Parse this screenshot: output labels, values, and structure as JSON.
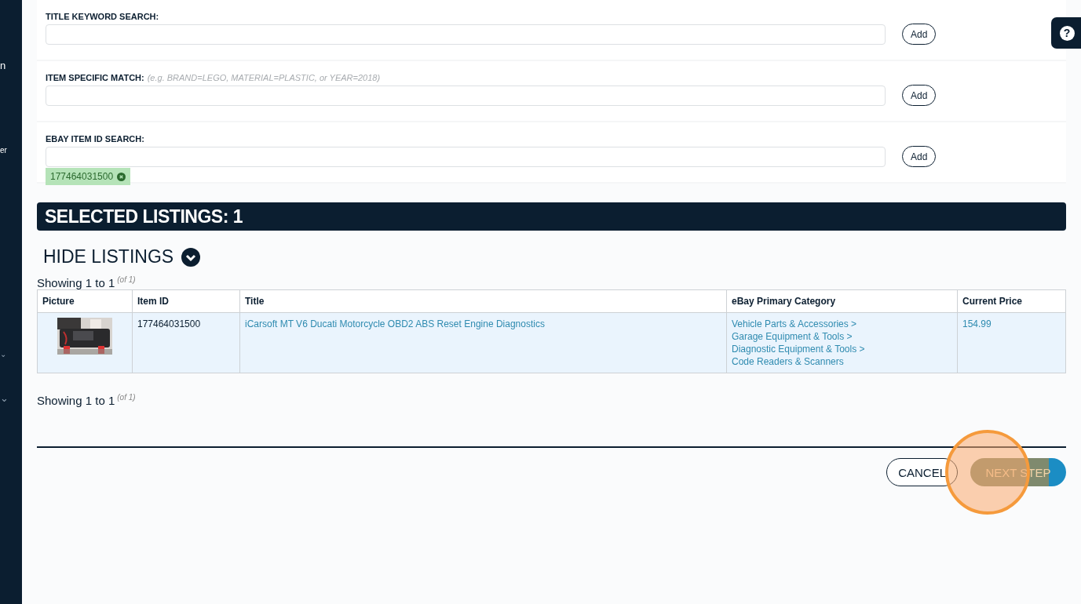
{
  "sidebar": {
    "items": [
      {
        "label": "n"
      },
      {
        "label": "er"
      },
      {
        "label": "⌄"
      },
      {
        "label": "⌄"
      }
    ]
  },
  "search_sections": [
    {
      "label": "TITLE KEYWORD SEARCH:",
      "button": "Add"
    },
    {
      "label": "ITEM SPECIFIC MATCH:",
      "hint": "(e.g. BRAND=LEGO, MATERIAL=PLASTIC, or YEAR=2018)",
      "button": "Add"
    },
    {
      "label": "EBAY ITEM ID SEARCH:",
      "button": "Add",
      "tags": [
        {
          "text": "177464031500"
        }
      ]
    }
  ],
  "help_button": "?",
  "selected_header": "SELECTED LISTINGS: 1",
  "toggle": {
    "label": "HIDE LISTINGS",
    "expanded": true
  },
  "pagination_top": {
    "text": "Showing 1 to 1",
    "total": "(of 1)"
  },
  "table": {
    "columns": [
      "Picture",
      "Item ID",
      "Title",
      "eBay Primary Category",
      "Current Price"
    ],
    "rows": [
      {
        "picture": {
          "kind": "picture"
        },
        "item_id": "177464031500",
        "title": "iCarsoft MT V6 Ducati Motorcycle OBD2 ABS Reset Engine Diagnostics",
        "category": [
          "Vehicle Parts & Accessories >",
          "Garage Equipment & Tools >",
          "Diagnostic Equipment & Tools >",
          "Code Readers & Scanners"
        ],
        "price": "154.99"
      }
    ]
  },
  "pagination_bottom": {
    "text": "Showing 1 to 1",
    "total": "(of 1)"
  },
  "footer_buttons": [
    {
      "label": "CANCEL",
      "kind": "secondary",
      "highlighted": false
    },
    {
      "label": "NEXT STEP",
      "kind": "primary",
      "highlighted": true
    }
  ]
}
